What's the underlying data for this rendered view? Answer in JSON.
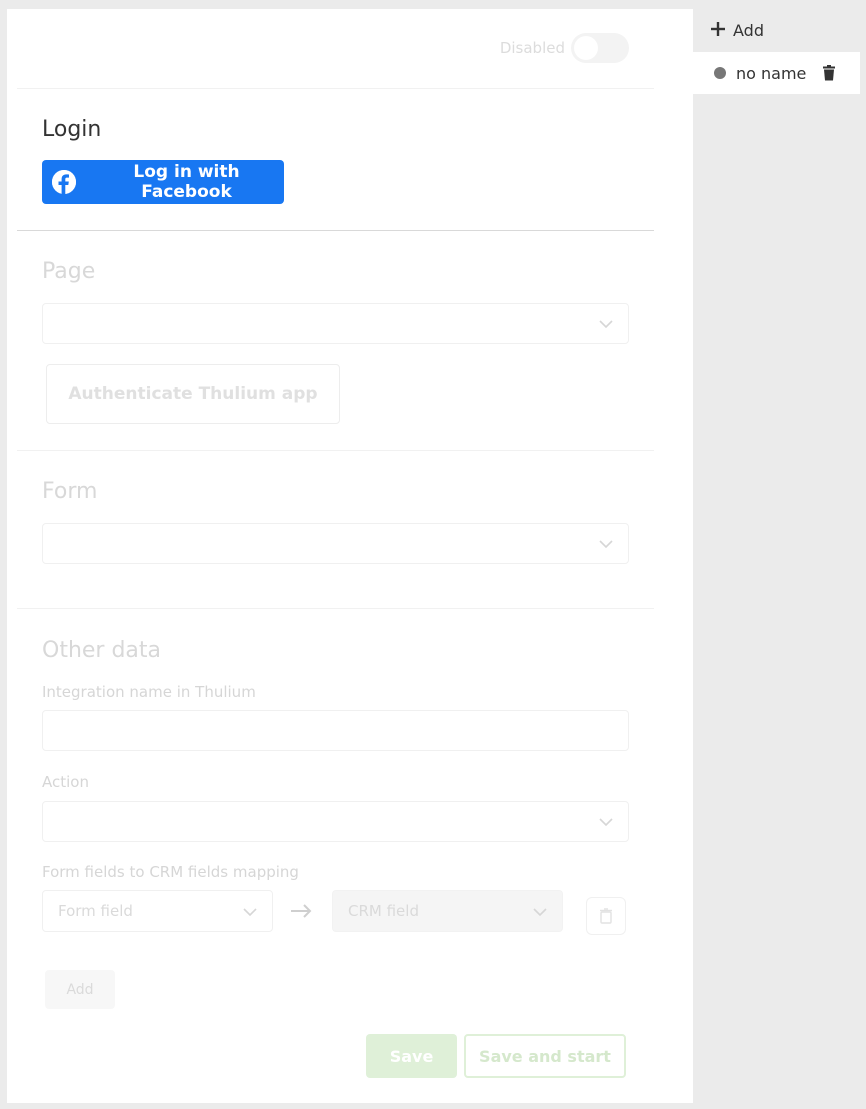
{
  "header": {
    "toggle_label": "Disabled",
    "toggle_on": false
  },
  "login": {
    "title": "Login",
    "facebook_button": "Log in with Facebook"
  },
  "page": {
    "title": "Page",
    "selected": "",
    "authenticate_button": "Authenticate Thulium app"
  },
  "form": {
    "title": "Form",
    "selected": ""
  },
  "other": {
    "title": "Other data",
    "integration_name_label": "Integration name in Thulium",
    "integration_name_value": "",
    "action_label": "Action",
    "action_selected": "",
    "mapping_label": "Form fields to CRM fields mapping",
    "form_field_placeholder": "Form field",
    "crm_field_placeholder": "CRM field",
    "add_button": "Add"
  },
  "footer": {
    "save_button": "Save",
    "save_and_start_button": "Save and start"
  },
  "sidebar": {
    "add_label": "Add",
    "items": [
      {
        "label": "no name",
        "status_color": "#777777"
      }
    ]
  },
  "colors": {
    "facebook_blue": "#1877f2",
    "success_light": "#dff0d8"
  }
}
